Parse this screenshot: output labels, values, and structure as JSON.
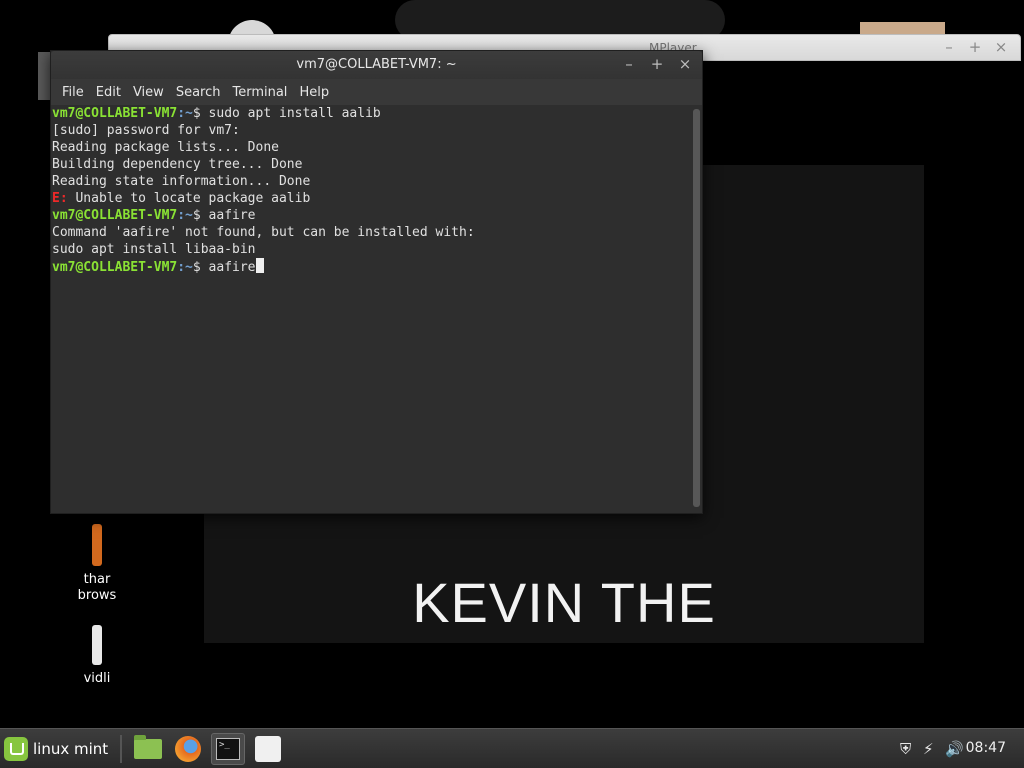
{
  "mplayer": {
    "title": "MPlayer",
    "subtitle": "KEVIN THE"
  },
  "desktop_icons": [
    {
      "name": "thar browse",
      "label_line1": "thar",
      "label_line2": "brows",
      "color": "#d2691e"
    },
    {
      "name": "vidli",
      "label_line1": "vidli",
      "label_line2": "",
      "color": "#e8e8e8"
    }
  ],
  "terminal": {
    "title": "vm7@COLLABET-VM7: ~",
    "menu": [
      "File",
      "Edit",
      "View",
      "Search",
      "Terminal",
      "Help"
    ],
    "prompt_user": "vm7@COLLABET-VM7",
    "prompt_path": ":~",
    "prompt_symbol": "$ ",
    "lines": [
      {
        "type": "cmd",
        "text": "sudo apt install aalib"
      },
      {
        "type": "out",
        "text": "[sudo] password for vm7:"
      },
      {
        "type": "out",
        "text": "Reading package lists... Done"
      },
      {
        "type": "out",
        "text": "Building dependency tree... Done"
      },
      {
        "type": "out",
        "text": "Reading state information... Done"
      },
      {
        "type": "err",
        "prefix": "E:",
        "text": " Unable to locate package aalib"
      },
      {
        "type": "cmd",
        "text": "aafire"
      },
      {
        "type": "out",
        "text": "Command 'aafire' not found, but can be installed with:"
      },
      {
        "type": "out",
        "text": "sudo apt install libaa-bin"
      },
      {
        "type": "cmd_current",
        "text": "aafire"
      }
    ],
    "colors": {
      "prompt": "#8ae234",
      "path": "#729fcf",
      "error": "#ef2929",
      "background": "#2e2e2e"
    }
  },
  "taskbar": {
    "menu_label": "linux mint",
    "apps": [
      "files-icon",
      "firefox-icon",
      "terminal-icon",
      "mplayer-icon"
    ],
    "clock": "08:47",
    "tray_icons": [
      "shield-icon",
      "network-icon",
      "volume-icon"
    ]
  }
}
